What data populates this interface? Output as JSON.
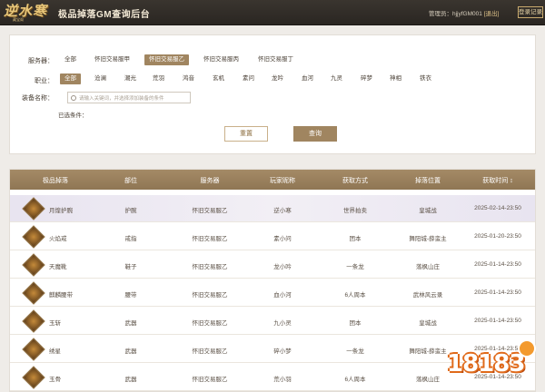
{
  "header": {
    "logo_text": "逆水寒",
    "logo_sub": "藏宝阁",
    "title": "极品掉落GM查询后台",
    "admin_label": "管理员：hjjyfGM001",
    "logout_label": "[退出]",
    "log_button": "登录记录"
  },
  "filter": {
    "server_label": "服务器：",
    "servers": [
      "全部",
      "怀旧交易服甲",
      "怀旧交易服乙",
      "怀旧交易服丙",
      "怀旧交易服丁"
    ],
    "server_selected_index": 2,
    "class_label": "职业：",
    "classes": [
      "全部",
      "沧澜",
      "潮光",
      "荒羽",
      "鸿音",
      "玄机",
      "素问",
      "龙吟",
      "血河",
      "九灵",
      "碎梦",
      "神相",
      "铁衣"
    ],
    "class_selected_index": 0,
    "equip_label": "装备名称：",
    "search_placeholder": "请输入关键词，并选择添加装备的条件",
    "selected_label": "已选条件：",
    "reset_label": "重置",
    "query_label": "查询"
  },
  "table": {
    "columns": [
      "极品掉落",
      "部位",
      "服务器",
      "玩家昵称",
      "获取方式",
      "掉落位置",
      "获取时间 ↕"
    ],
    "rows": [
      [
        "月煌护腕",
        "护腕",
        "怀旧交易服乙",
        "逆小寒",
        "世界拍卖",
        "皇城战",
        "2025-02-14-23:50"
      ],
      [
        "火焰戒",
        "戒指",
        "怀旧交易服乙",
        "素小问",
        "团本",
        "舞阳城-薛蛮主",
        "2025-01-20-23:50"
      ],
      [
        "天魔靴",
        "鞋子",
        "怀旧交易服乙",
        "龙小吟",
        "一条龙",
        "落枫山庄",
        "2025-01-14-23:50"
      ],
      [
        "麒麟腰带",
        "腰带",
        "怀旧交易服乙",
        "血小河",
        "6人周本",
        "武林风云录",
        "2025-01-14-23:50"
      ],
      [
        "玉斩",
        "武器",
        "怀旧交易服乙",
        "九小灵",
        "团本",
        "皇城战",
        "2025-01-14-23:50"
      ],
      [
        "绣星",
        "武器",
        "怀旧交易服乙",
        "碎小梦",
        "一条龙",
        "舞阳城-薛蛮主",
        "2025-01-14-23:50"
      ],
      [
        "玉骨",
        "武器",
        "怀旧交易服乙",
        "荒小羽",
        "6人周本",
        "落枫山庄",
        "2025-01-14-23:50"
      ]
    ]
  },
  "watermark": {
    "text": "18183"
  },
  "colors": {
    "accent": "#a08560",
    "header_bg": "#2f2b26",
    "table_head": "#9a8060"
  }
}
